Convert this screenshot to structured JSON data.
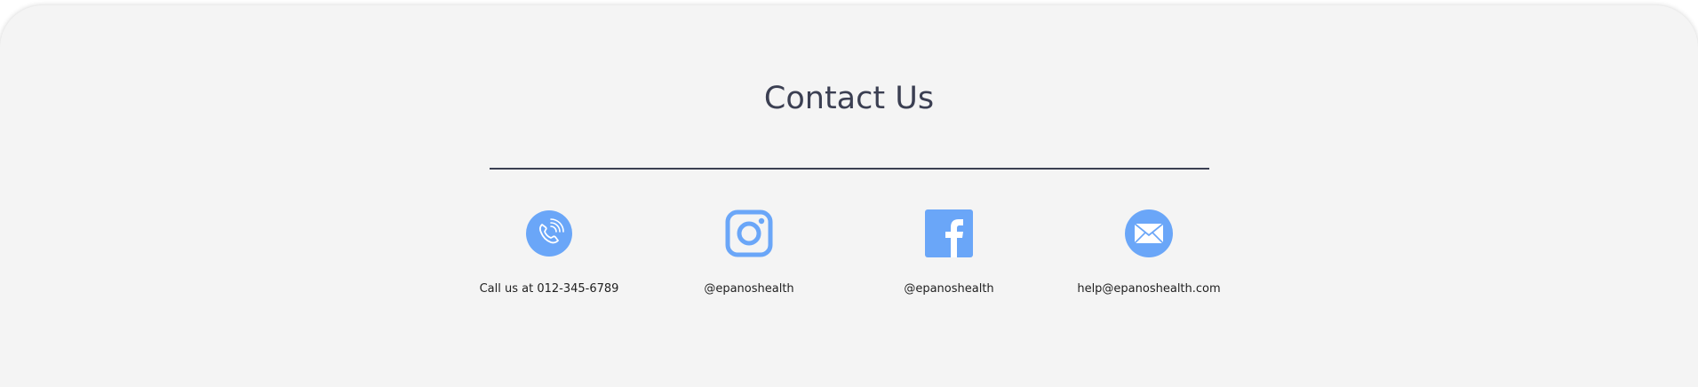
{
  "contact": {
    "title": "Contact Us",
    "accent_color": "#6aa6f8",
    "text_color": "#3b3f52",
    "items": [
      {
        "icon": "phone-icon",
        "label": "Call us at 012-345-6789"
      },
      {
        "icon": "instagram-icon",
        "label": "@epanoshealth"
      },
      {
        "icon": "facebook-icon",
        "label": "@epanoshealth"
      },
      {
        "icon": "email-icon",
        "label": "help@epanoshealth.com"
      }
    ]
  }
}
